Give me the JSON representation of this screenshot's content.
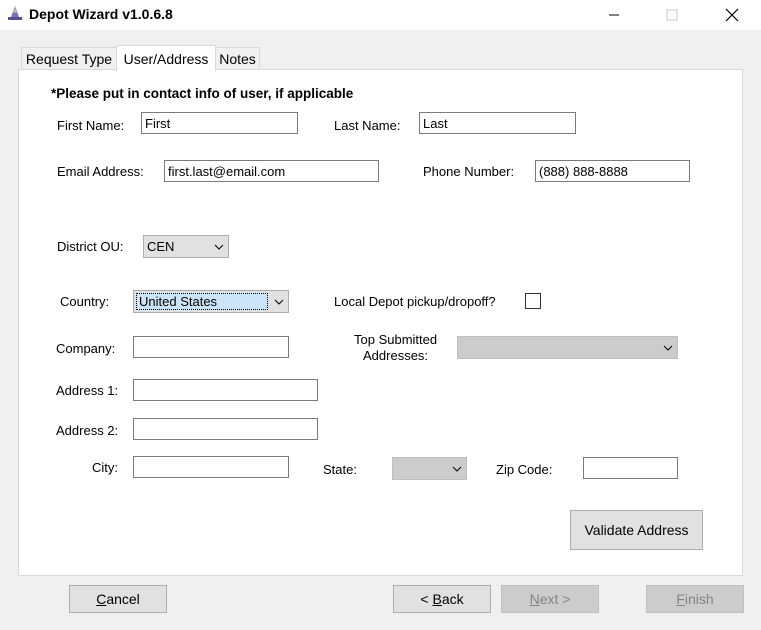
{
  "window": {
    "title": "Depot Wizard v1.0.6.8"
  },
  "tabs": [
    {
      "label": "Request Type",
      "active": false
    },
    {
      "label": "User/Address",
      "active": true
    },
    {
      "label": "Notes",
      "active": false
    }
  ],
  "form": {
    "instruction": "*Please put in contact info of user, if applicable",
    "first_name_label": "First Name:",
    "first_name_value": "First",
    "last_name_label": "Last Name:",
    "last_name_value": "Last",
    "email_label": "Email Address:",
    "email_value": "first.last@email.com",
    "phone_label": "Phone Number:",
    "phone_value": "(888) 888-8888",
    "district_label": "District OU:",
    "district_value": "CEN",
    "country_label": "Country:",
    "country_value": "United States",
    "local_depot_label": "Local Depot pickup/dropoff?",
    "local_depot_checked": false,
    "company_label": "Company:",
    "company_value": "",
    "top_submitted_label_line1": "Top Submitted",
    "top_submitted_label_line2": "Addresses:",
    "top_submitted_value": "",
    "address1_label": "Address 1:",
    "address1_value": "",
    "address2_label": "Address 2:",
    "address2_value": "",
    "city_label": "City:",
    "city_value": "",
    "state_label": "State:",
    "state_value": "",
    "zip_label": "Zip Code:",
    "zip_value": "",
    "validate_label": "Validate Address"
  },
  "footer": {
    "cancel_prefix": "",
    "cancel_mnemonic": "C",
    "cancel_rest": "ancel",
    "back_prefix": "< ",
    "back_mnemonic": "B",
    "back_rest": "ack",
    "next_prefix": "",
    "next_mnemonic": "N",
    "next_rest": "ext >",
    "finish_prefix": "",
    "finish_mnemonic": "F",
    "finish_rest": "inish"
  },
  "icons": {
    "app": "wizard-hat-icon",
    "minimize": "minimize-icon",
    "maximize": "maximize-icon",
    "close": "close-icon",
    "dropdown": "chevron-down-icon"
  }
}
